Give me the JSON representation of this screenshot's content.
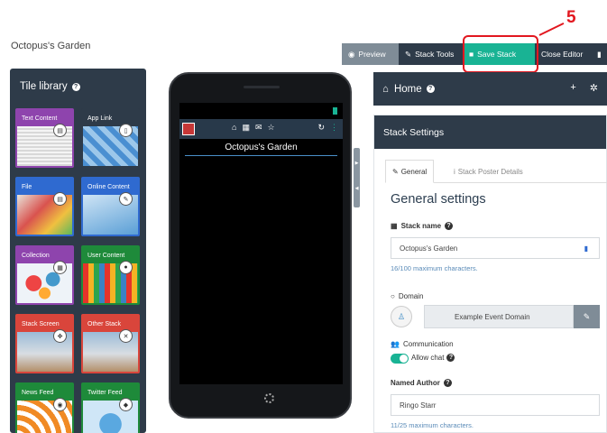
{
  "app": {
    "title": "Octopus's Garden"
  },
  "annotation": {
    "step": "5"
  },
  "toolbar": {
    "preview": "Preview",
    "stack_tools": "Stack Tools",
    "save_stack": "Save Stack",
    "close_editor": "Close Editor"
  },
  "tile_library": {
    "title": "Tile library",
    "help": "?",
    "tiles": [
      {
        "label": "Text Content",
        "color": "#8e44ad",
        "icon": "document-icon",
        "glyph": "▤"
      },
      {
        "label": "App Link",
        "color": "#2e3b49",
        "icon": "phone-icon",
        "glyph": "▯"
      },
      {
        "label": "File",
        "color": "#2f6ad0",
        "icon": "file-icon",
        "glyph": "▤"
      },
      {
        "label": "Online Content",
        "color": "#2f6ad0",
        "icon": "edit-icon",
        "glyph": "✎"
      },
      {
        "label": "Collection",
        "color": "#8e44ad",
        "icon": "grid-icon",
        "glyph": "▦"
      },
      {
        "label": "User Content",
        "color": "#1e8a3a",
        "icon": "user-icon",
        "glyph": "●"
      },
      {
        "label": "Stack Screen",
        "color": "#d9453b",
        "icon": "move-icon",
        "glyph": "✥"
      },
      {
        "label": "Other Stack",
        "color": "#d9453b",
        "icon": "shuffle-icon",
        "glyph": "✕"
      },
      {
        "label": "News Feed",
        "color": "#1e8a3a",
        "icon": "rss-icon",
        "glyph": "◉"
      },
      {
        "label": "Twitter Feed",
        "color": "#1e8a3a",
        "icon": "twitter-icon",
        "glyph": "◆"
      }
    ]
  },
  "phone": {
    "title": "Octopus's Garden",
    "nav_icons": [
      "home-icon",
      "grid-icon",
      "chat-icon",
      "star-icon"
    ],
    "nav_glyphs": [
      "⌂",
      "▦",
      "✉",
      "☆"
    ],
    "right_glyphs": [
      "↻",
      "⋮"
    ]
  },
  "home_panel": {
    "title": "Home",
    "help": "?",
    "add": "+",
    "gear": "✲"
  },
  "stack_settings": {
    "title": "Stack Settings",
    "tab_general": "General",
    "tab_poster": "Stack Poster Details",
    "section_title": "General settings",
    "stack_name_label": "Stack name",
    "stack_name_value": "Octopus's Garden",
    "stack_name_hint": "16/100 maximum characters.",
    "domain_label": "Domain",
    "domain_value": "Example Event Domain",
    "communication_label": "Communication",
    "allow_chat_label": "Allow chat",
    "allow_chat_on": true,
    "author_label": "Named Author",
    "author_value": "Ringo Starr",
    "author_hint": "11/25 maximum characters."
  },
  "colors": {
    "navy": "#2e3b49",
    "save_green": "#19b394",
    "highlight_red": "#e2171f"
  }
}
